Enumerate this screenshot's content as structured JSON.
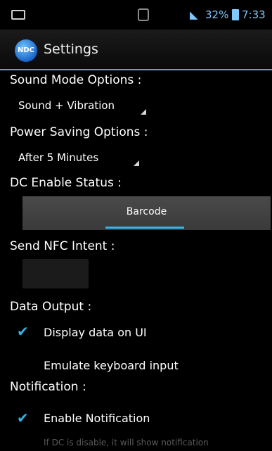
{
  "status_bar": {
    "signal_icon": "signal-icon",
    "battery_percent": "32%",
    "time": "7:33",
    "status_color": "#7fc8ff"
  },
  "action_bar": {
    "app_icon_text": "NDC",
    "title": "Settings"
  },
  "sound_mode": {
    "label": "Sound Mode Options :",
    "value": "Sound + Vibration"
  },
  "power_saving": {
    "label": "Power Saving Options :",
    "value": "After 5 Minutes"
  },
  "dc_enable": {
    "label": "DC Enable Status :",
    "button_label": "Barcode"
  },
  "nfc_intent": {
    "label": "Send NFC Intent :"
  },
  "data_output": {
    "label": "Data Output :",
    "options": [
      {
        "label": "Display data on UI",
        "checked": true
      },
      {
        "label": "Emulate keyboard input",
        "checked": false
      }
    ]
  },
  "notification": {
    "label": "Notification :",
    "options": [
      {
        "label": "Enable Notification",
        "checked": true
      }
    ],
    "hint": "If DC is disable, it will show notification"
  },
  "accent_color": "#33b5e5"
}
